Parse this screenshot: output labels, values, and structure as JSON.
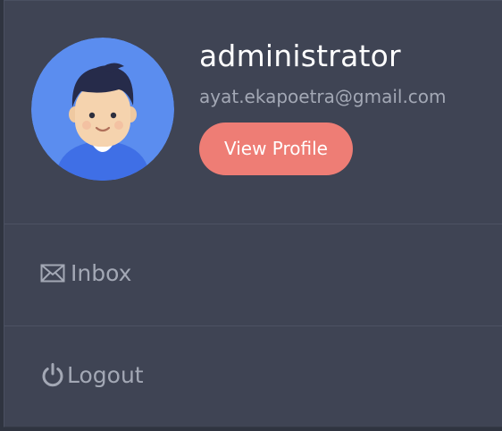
{
  "profile": {
    "name": "administrator",
    "email": "ayat.ekapoetra@gmail.com",
    "view_profile_label": "View Profile",
    "avatar_icon": "person-avatar-icon"
  },
  "menu": {
    "items": [
      {
        "label": "Inbox",
        "icon": "envelope-icon"
      },
      {
        "label": "Logout",
        "icon": "power-icon"
      }
    ]
  },
  "colors": {
    "panel_background": "#3f4454",
    "avatar_background": "#5b8def",
    "button_background": "#ee7d75",
    "muted_text": "#a3a8b5",
    "name_text": "#ffffff"
  }
}
